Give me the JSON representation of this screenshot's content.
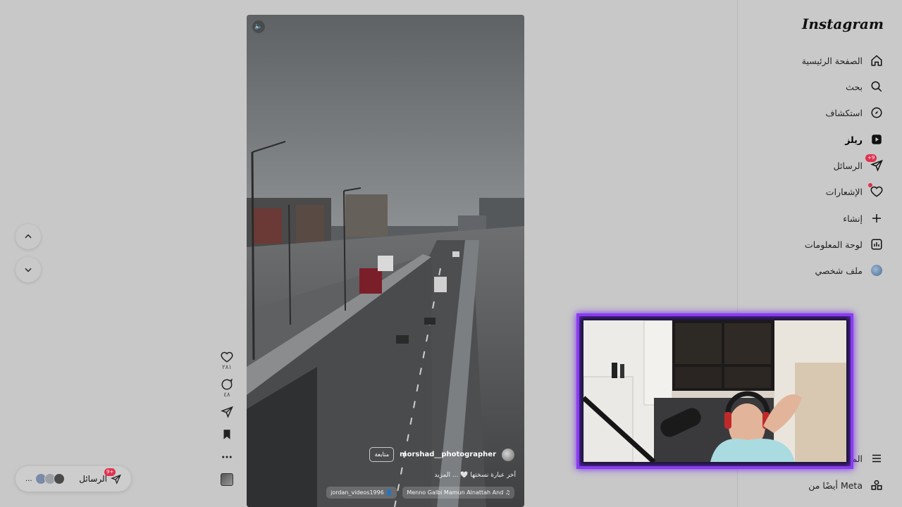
{
  "app": {
    "logo": "Instagram"
  },
  "sidebar": {
    "items": [
      {
        "label": "الصفحة الرئيسية",
        "icon": "home-icon"
      },
      {
        "label": "بحث",
        "icon": "search-icon"
      },
      {
        "label": "استكشاف",
        "icon": "compass-icon"
      },
      {
        "label": "ريلز",
        "icon": "reels-icon",
        "active": true
      },
      {
        "label": "الرسائل",
        "icon": "messages-icon",
        "badge": "+9"
      },
      {
        "label": "الإشعارات",
        "icon": "heart-icon"
      },
      {
        "label": "إنشاء",
        "icon": "plus-icon"
      },
      {
        "label": "لوحة المعلومات",
        "icon": "dashboard-icon"
      },
      {
        "label": "ملف شخصي",
        "icon": "profile-avatar"
      }
    ],
    "more_label": "المزيد",
    "meta_label": "أيضًا من Meta"
  },
  "reel": {
    "username": "morshad__photographer",
    "follow_label": "متابعة",
    "caption": "آخر عبارة نسختها 🤍 ... المزيد",
    "audio_label": "Menno Galbi  Mamun Alnattah And",
    "tagged_user": "jordan_videos1996",
    "likes": "٢٨١",
    "comments": "٤٨"
  },
  "messages_pill": {
    "label": "الرسائل",
    "badge": "+9",
    "more": "..."
  },
  "colors": {
    "accent": "#8a3cf0",
    "badge": "#e0314f",
    "background": "#c8c8c8"
  }
}
